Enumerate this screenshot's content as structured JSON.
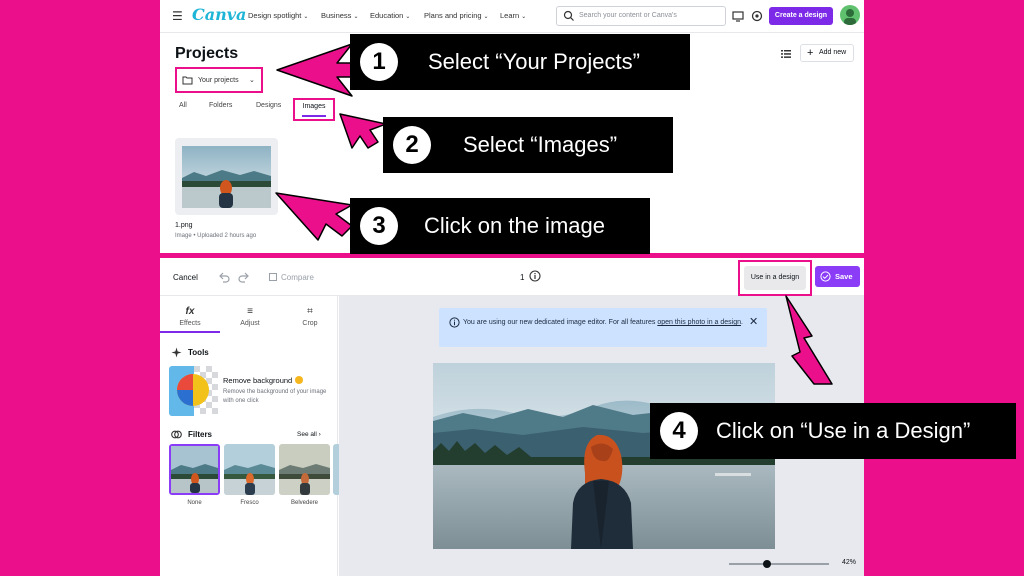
{
  "nav": {
    "logo": "Canva",
    "items": [
      "Design spotlight",
      "Business",
      "Education",
      "Plans and pricing",
      "Learn"
    ],
    "search_placeholder": "Search your content or Canva's",
    "create_label": "Create a design"
  },
  "projects": {
    "title": "Projects",
    "selector_label": "Your projects",
    "add_new": "Add new",
    "tabs": [
      "All",
      "Folders",
      "Designs",
      "Images"
    ],
    "file": {
      "name": "1.png",
      "meta": "Image • Uploaded 2 hours ago"
    }
  },
  "editor": {
    "cancel": "Cancel",
    "compare": "Compare",
    "page_number": "1",
    "use_in_design": "Use in a design",
    "save": "Save",
    "side_tabs": [
      {
        "glyph": "fx",
        "label": "Effects"
      },
      {
        "glyph": "≡",
        "label": "Adjust"
      },
      {
        "glyph": "⌗",
        "label": "Crop"
      }
    ],
    "tools_title": "Tools",
    "remove_bg_title": "Remove background",
    "remove_bg_desc": "Remove the background of your image with one click",
    "filters_title": "Filters",
    "see_all": "See all",
    "filters": [
      "None",
      "Fresco",
      "Belvedere"
    ],
    "notice_text": "You are using our new dedicated image editor. For all features",
    "notice_link": "open this photo in a design",
    "notice_end": ".",
    "zoom": "42%"
  },
  "callouts": [
    {
      "num": "1",
      "text": "Select “Your Projects”"
    },
    {
      "num": "2",
      "text": "Select “Images”"
    },
    {
      "num": "3",
      "text": "Click on the image"
    },
    {
      "num": "4",
      "text": "Click on “Use in a Design”"
    }
  ],
  "colors": {
    "background": "#ec0f8c",
    "accent": "#7d2ae8",
    "highlight": "#ec0f8c"
  }
}
